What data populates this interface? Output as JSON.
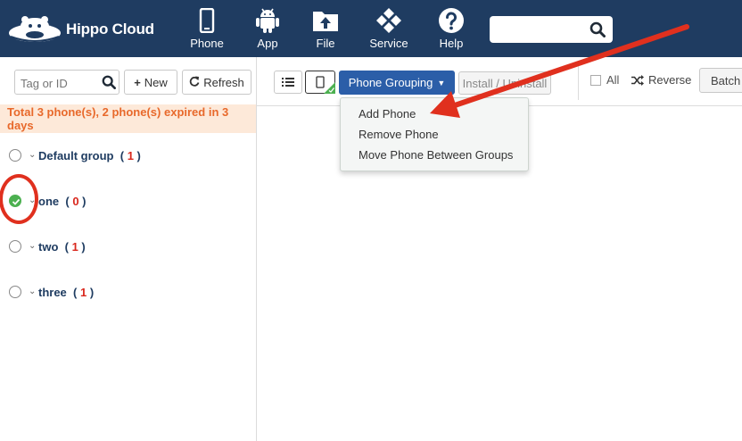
{
  "app": {
    "name": "Hippo Cloud"
  },
  "nav": {
    "items": [
      {
        "label": "Phone",
        "icon": "phone-icon"
      },
      {
        "label": "App",
        "icon": "android-icon"
      },
      {
        "label": "File",
        "icon": "upload-folder-icon"
      },
      {
        "label": "Service",
        "icon": "service-diamond-icon"
      },
      {
        "label": "Help",
        "icon": "question-circle-icon"
      }
    ],
    "search": {
      "value": "",
      "placeholder": ""
    }
  },
  "sidebar": {
    "tag_search_placeholder": "Tag or ID",
    "new_label": "New",
    "refresh_label": "Refresh",
    "notice": "Total 3 phone(s), 2 phone(s) expired in 3 days",
    "groups": [
      {
        "name": "Default group",
        "count": "1",
        "selected": false
      },
      {
        "name": "one",
        "count": "0",
        "selected": true
      },
      {
        "name": "two",
        "count": "1",
        "selected": false
      },
      {
        "name": "three",
        "count": "1",
        "selected": false
      }
    ]
  },
  "toolbar": {
    "grouping_label": "Phone Grouping",
    "install_label": "Install / Uninstall",
    "all_label": "All",
    "reverse_label": "Reverse",
    "batch_label": "Batch"
  },
  "dropdown": {
    "items": [
      "Add Phone",
      "Remove Phone",
      "Move Phone Between Groups"
    ]
  },
  "colors": {
    "topbar": "#1f3c61",
    "primary_button": "#2b5ea8",
    "notice_text": "#e8692b",
    "notice_bg": "#fde9d9",
    "count_red": "#d9281e",
    "selected_green": "#4cb050",
    "annotation_red": "#e0301e"
  }
}
